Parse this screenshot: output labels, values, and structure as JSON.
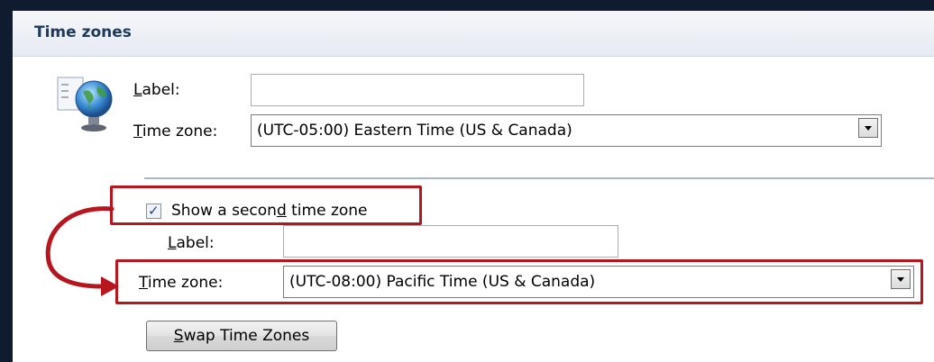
{
  "section": {
    "title": "Time zones"
  },
  "primary": {
    "label_caption_key": "L",
    "label_caption_rest": "abel:",
    "label_value": "",
    "timezone_caption_key": "T",
    "timezone_caption_rest": "ime zone:",
    "timezone_value": "(UTC-05:00) Eastern Time (US & Canada)"
  },
  "secondary": {
    "checkbox_checked": true,
    "checkbox_label_pre": "Show a secon",
    "checkbox_label_key": "d",
    "checkbox_label_post": " time zone",
    "label_caption_key": "L",
    "label_caption_rest": "abel:",
    "label_value": "",
    "timezone_caption_key": "T",
    "timezone_caption_rest": "ime zone:",
    "timezone_value": "(UTC-08:00) Pacific Time (US & Canada)"
  },
  "swap_button": {
    "key": "S",
    "rest": "wap Time Zones"
  },
  "colors": {
    "callout": "#b8161f",
    "header_text": "#1e395b",
    "background": "#0f1b2e"
  }
}
